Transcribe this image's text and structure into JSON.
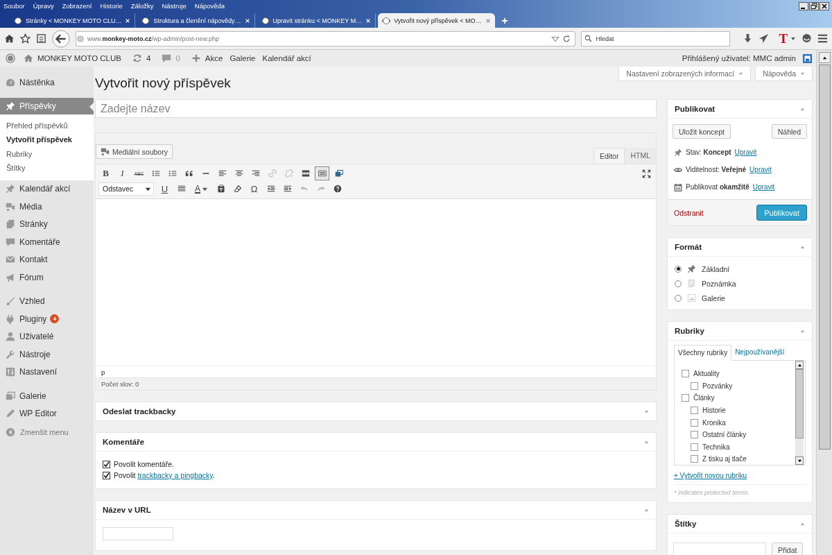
{
  "menu_bar": [
    "Soubor",
    "Úpravy",
    "Zobrazení",
    "Historie",
    "Záložky",
    "Nástroje",
    "Nápověda"
  ],
  "browser_tabs": [
    {
      "title": "Stránky < MONKEY MOTO CLU…",
      "selected": false
    },
    {
      "title": "Struktura a členění nápovědy…",
      "selected": false
    },
    {
      "title": "Upravit stránku < MONKEY M…",
      "selected": false
    },
    {
      "title": "Vytvořit nový příspěvek < MO…",
      "selected": true
    }
  ],
  "address_bar": {
    "url": "www.**monkey-moto.cz**/wp-admin/post-new.php"
  },
  "search_field": {
    "placeholder": "Hledat"
  },
  "addon_letter": "T",
  "admin_bar": {
    "site": "MONKEY MOTO CLUB",
    "updates": "4",
    "comments": "0",
    "new_label": "Akce",
    "links": [
      "Galerie",
      "Kalendář akcí"
    ],
    "account": "Přihlášený uživatel: MMC admin"
  },
  "screen_options": [
    "Nastavení zobrazených informací",
    "Nápověda"
  ],
  "sidebar": {
    "groups": [
      {
        "items": [
          {
            "label": "Nástěnka",
            "kind": "dashboard",
            "selected": false
          }
        ]
      },
      {
        "items": [
          {
            "label": "Příspěvky",
            "kind": "pin",
            "selected": true,
            "submenu": [
              {
                "label": "Přehled příspěvků",
                "selected": false
              },
              {
                "label": "Vytvořit příspěvek",
                "selected": true
              },
              {
                "label": "Rubriky",
                "selected": false
              },
              {
                "label": "Štítky",
                "selected": false
              }
            ]
          },
          {
            "label": "Kalendář akcí",
            "kind": "pin",
            "selected": false
          },
          {
            "label": "Média",
            "kind": "media",
            "selected": false
          },
          {
            "label": "Stránky",
            "kind": "pages",
            "selected": false
          },
          {
            "label": "Komentáře",
            "kind": "comment",
            "selected": false
          },
          {
            "label": "Kontakt",
            "kind": "mail",
            "selected": false
          },
          {
            "label": "Fórum",
            "kind": "megaphone",
            "selected": false
          }
        ]
      },
      {
        "items": [
          {
            "label": "Vzhled",
            "kind": "brush",
            "selected": false
          },
          {
            "label": "Pluginy",
            "kind": "plug",
            "selected": false,
            "badge": "4"
          },
          {
            "label": "Uživatelé",
            "kind": "user",
            "selected": false
          },
          {
            "label": "Nástroje",
            "kind": "wrench",
            "selected": false
          },
          {
            "label": "Nastavení",
            "kind": "settings",
            "selected": false
          }
        ]
      },
      {
        "items": [
          {
            "label": "Galerie",
            "kind": "gallery",
            "selected": false
          },
          {
            "label": "WP Editor",
            "kind": "pencil",
            "selected": false
          }
        ]
      }
    ],
    "collapse": "Zmenšit menu"
  },
  "page_title": "Vytvořit nový příspěvek",
  "title_field": {
    "placeholder": "Zadejte název"
  },
  "editor": {
    "media_button": "Mediální soubory",
    "modes": [
      {
        "label": "Editor",
        "selected": true
      },
      {
        "label": "HTML",
        "selected": false
      }
    ],
    "toolbar_rows": [
      [
        {
          "kind": "bold",
          "label": "B",
          "disabled": false,
          "pressed": false
        },
        {
          "kind": "italic",
          "label": "I",
          "disabled": false,
          "pressed": false
        },
        {
          "kind": "strikethrough",
          "label": "ABC",
          "disabled": false,
          "pressed": false
        },
        {
          "kind": "bullet-list",
          "disabled": false,
          "pressed": false
        },
        {
          "kind": "numbered-list",
          "disabled": false,
          "pressed": false
        },
        {
          "kind": "quote",
          "disabled": false,
          "pressed": false
        },
        {
          "kind": "horizontal-line",
          "disabled": false,
          "pressed": false
        },
        {
          "kind": "align-left",
          "disabled": false,
          "pressed": false
        },
        {
          "kind": "align-center",
          "disabled": false,
          "pressed": false
        },
        {
          "kind": "align-right",
          "disabled": false,
          "pressed": false
        },
        {
          "kind": "link",
          "disabled": true,
          "pressed": false
        },
        {
          "kind": "unlink",
          "disabled": true,
          "pressed": false
        },
        {
          "kind": "read-more",
          "disabled": false,
          "pressed": false
        },
        {
          "kind": "toolbar-toggle",
          "disabled": false,
          "pressed": true
        },
        {
          "kind": "add-media",
          "disabled": false,
          "pressed": false
        }
      ],
      [
        {
          "kind": "format-select",
          "label": "Odstavec"
        },
        {
          "kind": "underline",
          "label": "U",
          "disabled": false,
          "pressed": false
        },
        {
          "kind": "justify",
          "disabled": false,
          "pressed": false
        },
        {
          "kind": "text-color",
          "label": "A",
          "disabled": false,
          "pressed": false
        },
        {
          "kind": "paste-text",
          "disabled": false,
          "pressed": false
        },
        {
          "kind": "eraser",
          "disabled": false,
          "pressed": false
        },
        {
          "kind": "special-character",
          "label": "Ω",
          "disabled": false,
          "pressed": false
        },
        {
          "kind": "outdent",
          "disabled": false,
          "pressed": false
        },
        {
          "kind": "indent",
          "disabled": false,
          "pressed": false
        },
        {
          "kind": "undo",
          "disabled": true,
          "pressed": false
        },
        {
          "kind": "redo",
          "disabled": true,
          "pressed": false
        },
        {
          "kind": "help",
          "disabled": false,
          "pressed": false
        }
      ]
    ],
    "path": "p",
    "word_count": "Počet slov: 0"
  },
  "main_boxes": [
    {
      "title": "Odeslat trackbacky",
      "expanded": false
    },
    {
      "title": "Komentáře",
      "expanded": true,
      "kind": "checks",
      "options": [
        {
          "text": "Povolit komentáře.",
          "checked": true
        },
        {
          "text": "Povolit ",
          "link": "trackbacky a pingbacky",
          "after": ".",
          "checked": true
        }
      ]
    },
    {
      "title": "Název v URL",
      "expanded": true,
      "kind": "input"
    }
  ],
  "publish_box": {
    "title": "Publikovat",
    "expanded": true,
    "save_button": "Uložit koncept",
    "preview_button": "Náhled",
    "rows": [
      {
        "kind": "pin",
        "text": "Stav: **Koncept**",
        "link": "Upravit"
      },
      {
        "kind": "eye",
        "text": "Viditelnost: **Veřejné**",
        "link": "Upravit"
      },
      {
        "kind": "calendar",
        "text": "Publikovat **okamžitě**",
        "link": "Upravit"
      }
    ],
    "delete_link": "Odstranit",
    "publish_button": "Publikovat"
  },
  "format_box": {
    "title": "Formát",
    "expanded": true,
    "options": [
      {
        "label": "Základní",
        "kind": "pin",
        "selected": true
      },
      {
        "label": "Poznámka",
        "kind": "note",
        "selected": false
      },
      {
        "label": "Galerie",
        "kind": "image",
        "selected": false
      }
    ]
  },
  "categories_box": {
    "title": "Rubriky",
    "expanded": true,
    "tabs": [
      {
        "label": "Všechny rubriky",
        "selected": true
      },
      {
        "label": "Nejpoužívanější",
        "selected": false
      }
    ],
    "categories": [
      {
        "label": "Aktuality",
        "checked": false,
        "children": [
          {
            "label": "Pozvánky",
            "checked": false
          }
        ]
      },
      {
        "label": "Články",
        "checked": false,
        "children": [
          {
            "label": "Historie",
            "checked": false
          },
          {
            "label": "Kronika",
            "checked": false
          },
          {
            "label": "Ostatní články",
            "checked": false
          },
          {
            "label": "Technika",
            "checked": false
          },
          {
            "label": "Z tisku aj tlače",
            "checked": false
          }
        ]
      }
    ],
    "add_link": "+ Vytvořit novou rubriku",
    "note": "* indicates protected terms."
  },
  "tags_box": {
    "title": "Štítky",
    "expanded": true,
    "add_button": "Přidat"
  }
}
